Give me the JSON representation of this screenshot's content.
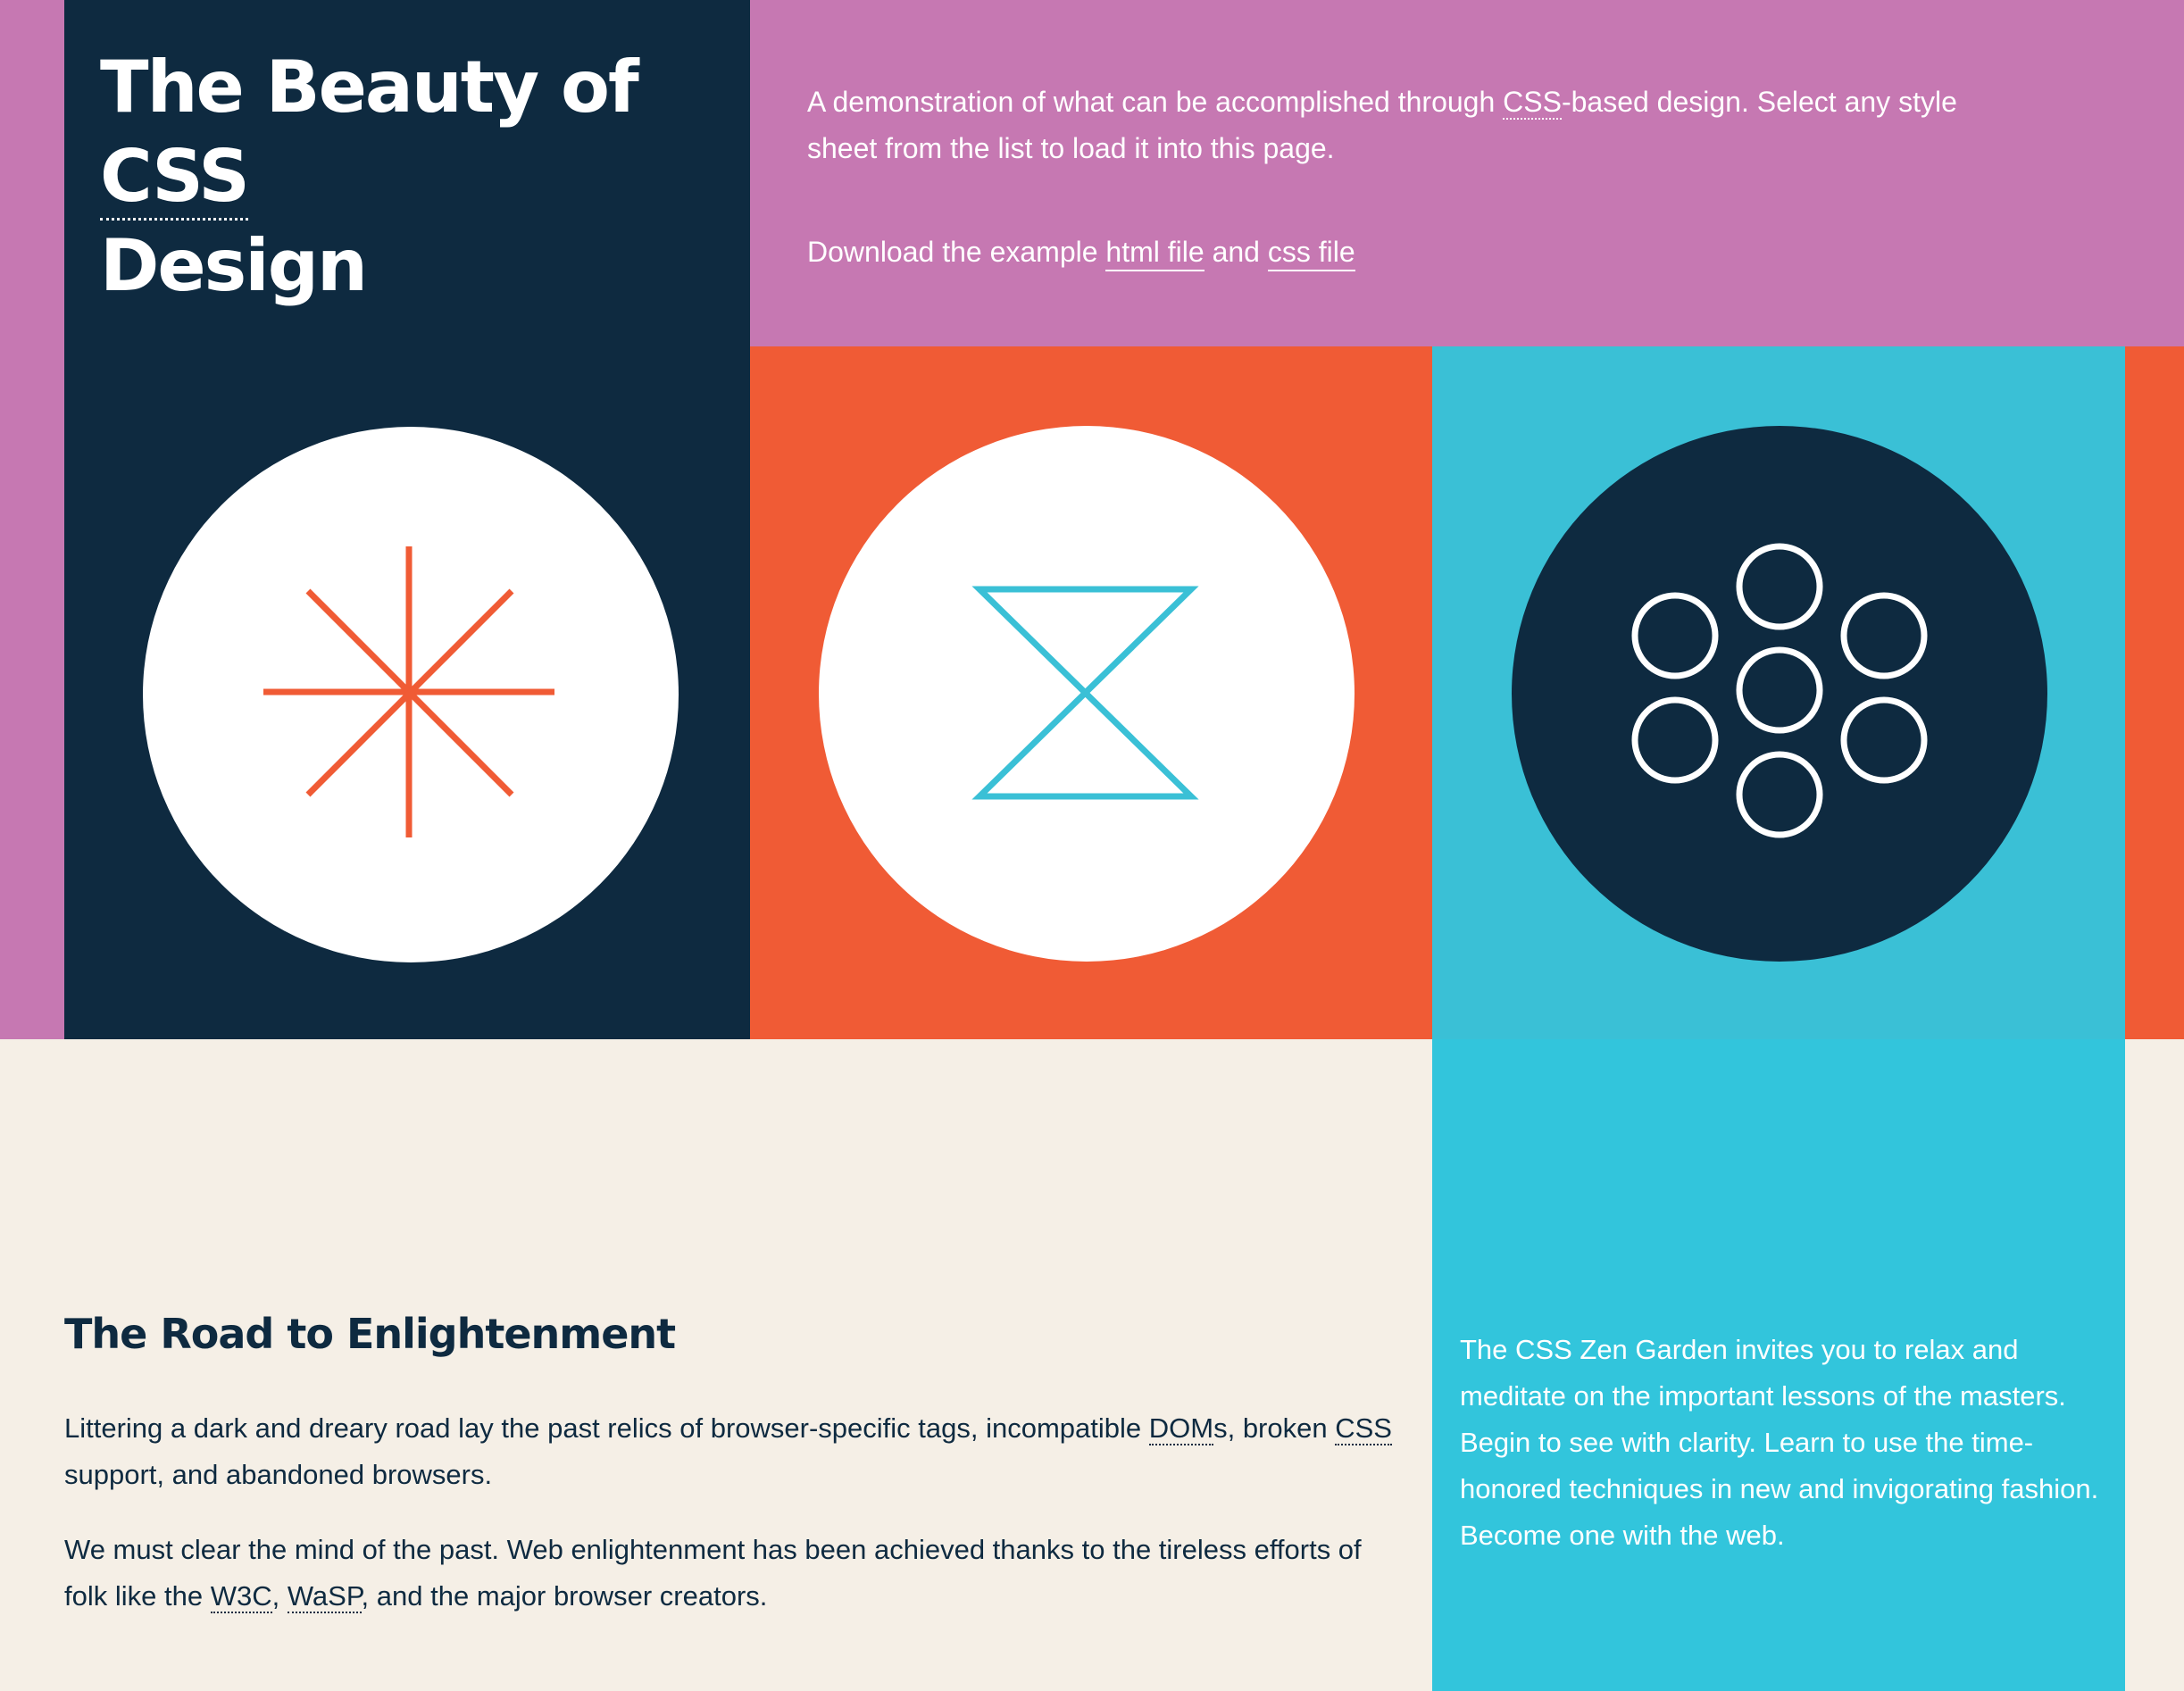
{
  "header": {
    "title_prefix": "The Beauty of ",
    "title_abbr": "CSS",
    "title_suffix": "Design"
  },
  "intro": {
    "summary_before": "A demonstration of what can be accomplished through ",
    "summary_abbr": "CSS",
    "summary_after": "-based design. Select any style sheet from the list to load it into this page.",
    "download_prefix": "Download the example ",
    "html_link": "html file",
    "download_and": " and ",
    "css_link": "css file"
  },
  "icons": {
    "left": "asterisk-burst-icon",
    "middle": "hourglass-icon",
    "right": "seven-circles-icon"
  },
  "road": {
    "heading": "The Road to Enlightenment",
    "p1_before": "Littering a dark and dreary road lay the past relics of browser-specific tags, incompatible ",
    "p1_abbr_dom": "DOM",
    "p1_mid": "s, broken ",
    "p1_abbr_css": "CSS",
    "p1_after": " support, and abandoned browsers.",
    "p2_before": "We must clear the mind of the past. Web enlightenment has been achieved thanks to the tireless efforts of folk like the ",
    "p2_abbr_w3c": "W3C",
    "p2_comma": ", ",
    "p2_abbr_wasp": "WaSP",
    "p2_after": ", and the major browser creators."
  },
  "zen": {
    "text": "The CSS Zen Garden invites you to relax and meditate on the important lessons of the masters. Begin to see with clarity. Learn to use the time-honored techniques in new and invigorating fashion. Become one with the web."
  },
  "colors": {
    "navy": "#0e2a40",
    "pink": "#c678b2",
    "orange": "#f05b35",
    "cyan": "#3ac0d6",
    "cream": "#f5efe6",
    "white": "#ffffff"
  }
}
